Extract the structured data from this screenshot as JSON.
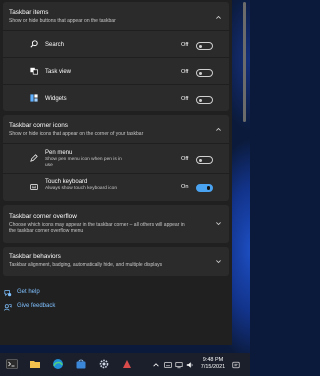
{
  "taskbar_items": {
    "title": "Taskbar items",
    "subtitle": "Show or hide buttons that appear on the taskbar",
    "rows": [
      {
        "label": "Search",
        "state": "Off"
      },
      {
        "label": "Task view",
        "state": "Off"
      },
      {
        "label": "Widgets",
        "state": "Off"
      }
    ]
  },
  "corner_icons": {
    "title": "Taskbar corner icons",
    "subtitle": "Show or hide icons that appear on the corner of your taskbar",
    "rows": [
      {
        "label": "Pen menu",
        "sub1": "Show pen menu icon when pen is in",
        "sub2": "use",
        "state": "Off"
      },
      {
        "label": "Touch keyboard",
        "sub1": "Always show touch keyboard icon",
        "state": "On"
      }
    ]
  },
  "corner_overflow": {
    "title": "Taskbar corner overflow",
    "sub1": "Choose which icons may appear in the taskbar corner – all others will appear in",
    "sub2": "the taskbar corner overflow menu"
  },
  "behaviors": {
    "title": "Taskbar behaviors",
    "subtitle": "Taskbar alignment, badging, automatically hide, and multiple displays"
  },
  "links": {
    "help": "Get help",
    "feedback": "Give feedback"
  },
  "taskbar": {
    "time": "9:48 PM",
    "date": "7/15/2021"
  },
  "colors": {
    "accent": "#4aa3f0",
    "link": "#7fc0ff",
    "panel": "#202020",
    "card": "#2b2b2b"
  }
}
